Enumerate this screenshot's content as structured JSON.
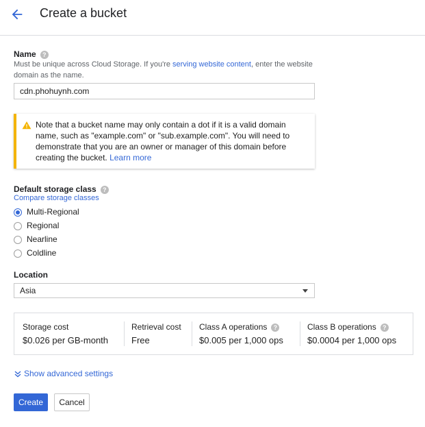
{
  "header": {
    "title": "Create a bucket",
    "back_icon": "arrow-left-icon"
  },
  "name": {
    "label": "Name",
    "hint_before": "Must be unique across Cloud Storage. If you're ",
    "hint_link": "serving website content",
    "hint_after": ", enter the website domain as the name.",
    "value": "cdn.phohuynh.com"
  },
  "warning": {
    "icon": "warning-icon",
    "text": "Note that a bucket name may only contain a dot if it is a valid domain name, such as \"example.com\" or \"sub.example.com\". You will need to demonstrate that you are an owner or manager of this domain before creating the bucket. ",
    "link": "Learn more",
    "color": "#f4b400"
  },
  "storage_class": {
    "label": "Default storage class",
    "compare_link": "Compare storage classes",
    "options": [
      {
        "label": "Multi-Regional",
        "selected": true
      },
      {
        "label": "Regional",
        "selected": false
      },
      {
        "label": "Nearline",
        "selected": false
      },
      {
        "label": "Coldline",
        "selected": false
      }
    ]
  },
  "location": {
    "label": "Location",
    "value": "Asia"
  },
  "costs": [
    {
      "label": "Storage cost",
      "value": "$0.026 per GB-month",
      "help": false
    },
    {
      "label": "Retrieval cost",
      "value": "Free",
      "help": false
    },
    {
      "label": "Class A operations",
      "value": "$0.005 per 1,000 ops",
      "help": true
    },
    {
      "label": "Class B operations",
      "value": "$0.0004 per 1,000 ops",
      "help": true
    }
  ],
  "advanced": {
    "label": "Show advanced settings"
  },
  "actions": {
    "create": "Create",
    "cancel": "Cancel"
  },
  "colors": {
    "accent": "#3367d6",
    "warning": "#f4b400"
  }
}
